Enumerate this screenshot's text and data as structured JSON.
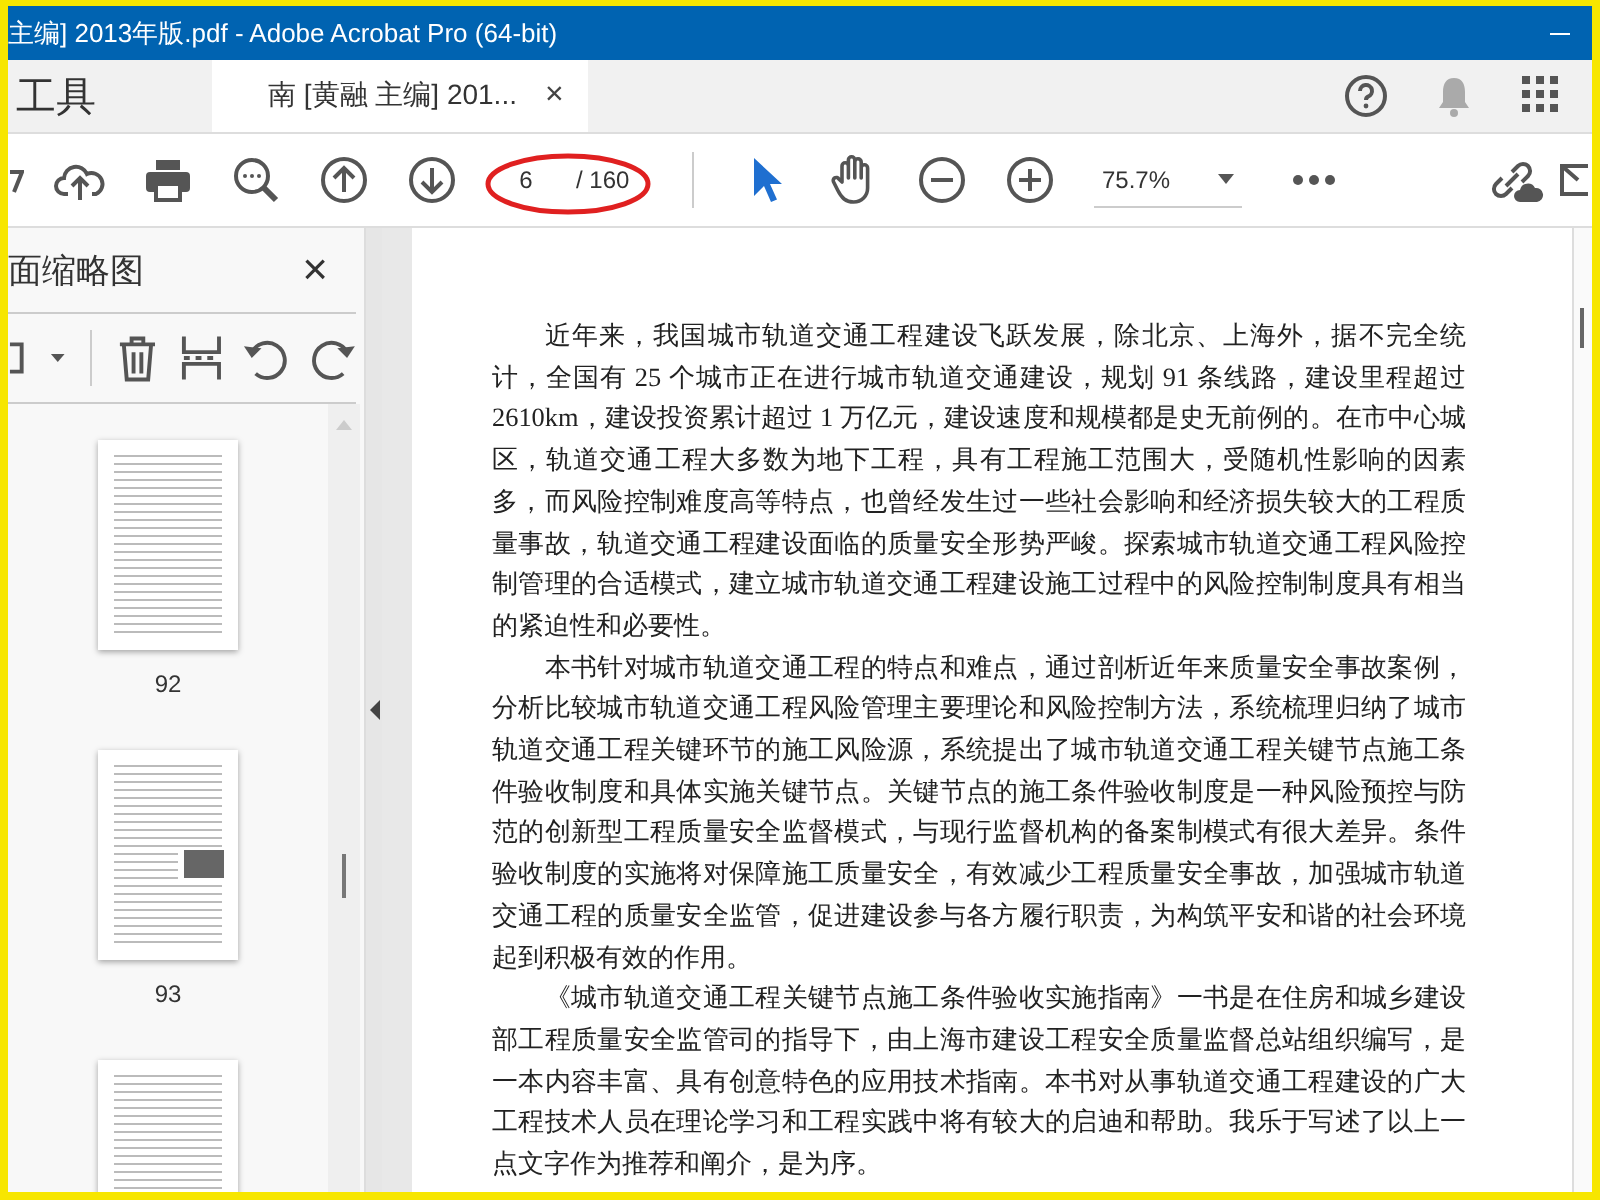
{
  "window": {
    "title": "主编] 2013年版.pdf - Adobe Acrobat Pro (64-bit)"
  },
  "tabs": [
    {
      "label": "工具",
      "selected": false
    },
    {
      "label": "南 [黄融 主编] 201...",
      "selected": true,
      "close": "×"
    }
  ],
  "toolbar": {
    "page_number": "6",
    "page_total": "/ 160",
    "zoom": "75.7%"
  },
  "sidebar": {
    "title": "面缩略图",
    "close": "×",
    "thumbnails": [
      {
        "kind": "page",
        "label": "92"
      },
      {
        "kind": "page",
        "label": "93"
      },
      {
        "kind": "page"
      }
    ]
  },
  "document": {
    "paragraphs": [
      "近年来，我国城市轨道交通工程建设飞跃发展，除北京、上海外，据不完全统计，全国有 25 个城市正在进行城市轨道交通建设，规划 91 条线路，建设里程超过 2610km，建设投资累计超过 1 万亿元，建设速度和规模都是史无前例的。在市中心城区，轨道交通工程大多数为地下工程，具有工程施工范围大，受随机性影响的因素多，而风险控制难度高等特点，也曾经发生过一些社会影响和经济损失较大的工程质量事故，轨道交通工程建设面临的质量安全形势严峻。探索城市轨道交通工程风险控制管理的合适模式，建立城市轨道交通工程建设施工过程中的风险控制制度具有相当的紧迫性和必要性。",
      "本书针对城市轨道交通工程的特点和难点，通过剖析近年来质量安全事故案例，分析比较城市轨道交通工程风险管理主要理论和风险控制方法，系统梳理归纳了城市轨道交通工程关键环节的施工风险源，系统提出了城市轨道交通工程关键节点施工条件验收制度和具体实施关键节点。关键节点的施工条件验收制度是一种风险预控与防范的创新型工程质量安全监督模式，与现行监督机构的备案制模式有很大差异。条件验收制度的实施将对保障施工质量安全，有效减少工程质量安全事故，加强城市轨道交通工程的质量安全监管，促进建设参与各方履行职责，为构筑平安和谐的社会环境起到积极有效的作用。",
      "《城市轨道交通工程关键节点施工条件验收实施指南》一书是在住房和城乡建设部工程质量安全监管司的指导下，由上海市建设工程安全质量监督总站组织编写，是一本内容丰富、具有创意特色的应用技术指南。本书对从事轨道交通工程建设的广大工程技术人员在理论学习和工程实践中将有较大的启迪和帮助。我乐于写述了以上一点文字作为推荐和阐介，是为序。"
    ]
  }
}
